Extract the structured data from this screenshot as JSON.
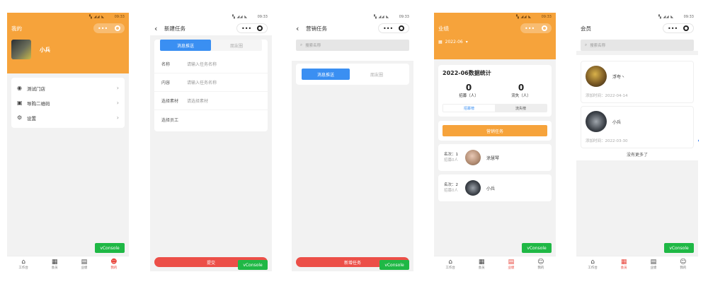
{
  "status_time": "09:33",
  "screen1": {
    "title": "我的",
    "user_name": "小兵",
    "menu": [
      {
        "icon": "location-icon",
        "glyph": "◉",
        "label": "测试门店"
      },
      {
        "icon": "qrcode-icon",
        "glyph": "▣",
        "label": "导购二维码"
      },
      {
        "icon": "gear-icon",
        "glyph": "⚙",
        "label": "设置"
      }
    ],
    "vconsole": "vConsole"
  },
  "screen2": {
    "title": "新建任务",
    "tab_active": "消息推送",
    "tab_inactive": "朋友圈",
    "fields": [
      {
        "label": "名称",
        "placeholder": "请输入任务名称"
      },
      {
        "label": "内容",
        "placeholder": "请输入任务名称"
      },
      {
        "label": "选择素材",
        "placeholder": "请选择素材"
      },
      {
        "label": "选择员工",
        "placeholder": ""
      }
    ],
    "submit": "提交",
    "vconsole": "vConsole"
  },
  "screen3": {
    "title": "营销任务",
    "search_placeholder": "搜索名称",
    "tab_active": "消息推送",
    "tab_inactive": "朋友圈",
    "new_task": "新增任务",
    "vconsole": "vConsole"
  },
  "screen4": {
    "title": "业绩",
    "month": "2022-06",
    "stats_title": "2022-06数据统计",
    "recruit_value": "0",
    "recruit_label": "招募（人）",
    "lost_value": "0",
    "lost_label": "流失（人）",
    "tab_active": "招募榜",
    "tab_inactive": "流失榜",
    "marketing_button": "营销任务",
    "ranks": [
      {
        "rank_label": "名次：1",
        "recruit": "招募0人",
        "name": "涂慧琴"
      },
      {
        "rank_label": "名次：2",
        "recruit": "招募0人",
        "name": "小兵"
      }
    ],
    "vconsole": "vConsole"
  },
  "screen5": {
    "title": "会员",
    "search_placeholder": "搜索名称",
    "members": [
      {
        "name": "浮夸丶",
        "added": "添加时间：2022-04-14"
      },
      {
        "name": "小兵",
        "added": "添加时间：2022-03-30"
      }
    ],
    "no_more": "没有更多了",
    "vconsole": "vConsole"
  },
  "tabbar": [
    {
      "label": "工作台",
      "icon": "home-icon",
      "glyph": "⌂"
    },
    {
      "label": "会员",
      "icon": "grid-icon",
      "glyph": "▦"
    },
    {
      "label": "业绩",
      "icon": "chart-icon",
      "glyph": "▤"
    },
    {
      "label": "我的",
      "icon": "smile-icon",
      "glyph": "☺"
    }
  ],
  "accent_orange": "#f6a33b",
  "accent_blue": "#3a8ff2",
  "accent_red": "#ec4f48",
  "vconsole_green": "#1fb845"
}
